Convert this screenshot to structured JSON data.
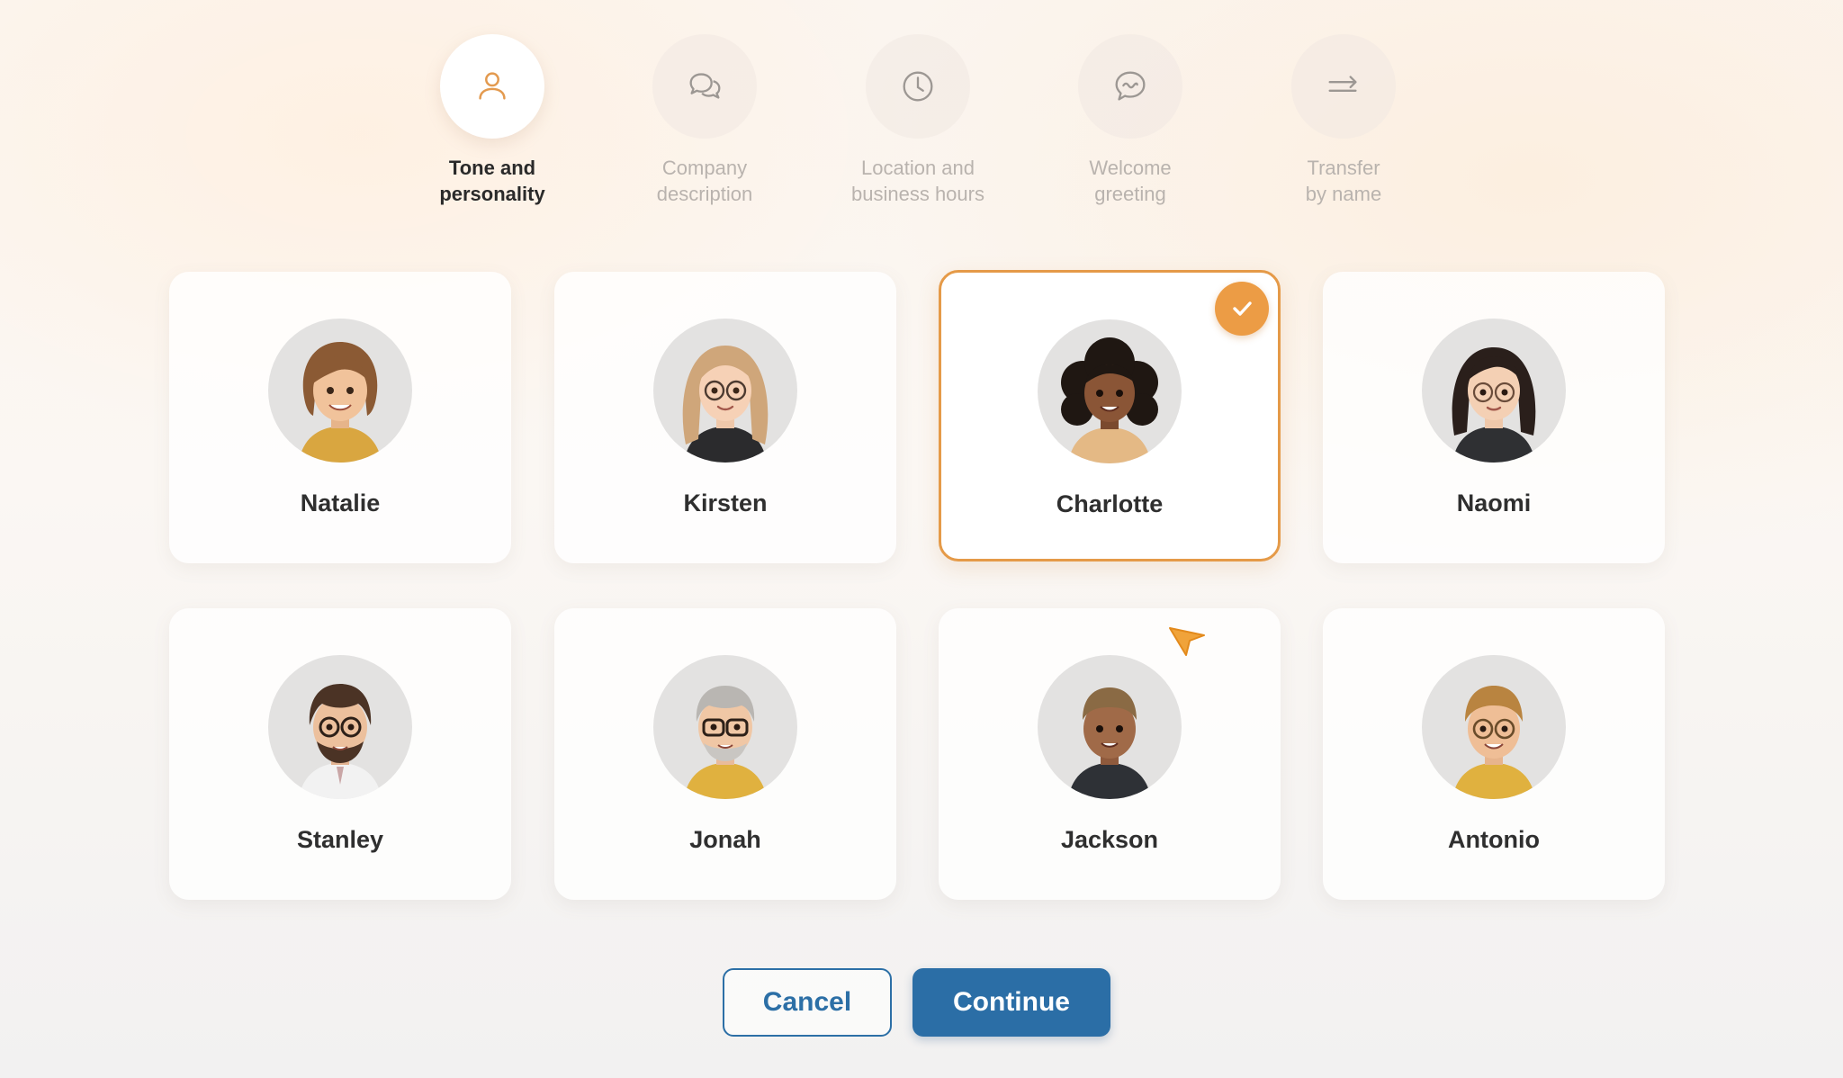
{
  "stepper": {
    "steps": [
      {
        "label": "Tone and\npersonality",
        "icon": "person-icon",
        "active": true
      },
      {
        "label": "Company\ndescription",
        "icon": "chat-bubbles-icon",
        "active": false
      },
      {
        "label": "Location and\nbusiness hours",
        "icon": "clock-icon",
        "active": false
      },
      {
        "label": "Welcome\ngreeting",
        "icon": "message-wave-icon",
        "active": false
      },
      {
        "label": "Transfer\nby name",
        "icon": "transfer-arrows-icon",
        "active": false
      }
    ]
  },
  "personas": [
    {
      "name": "Natalie",
      "selected": false
    },
    {
      "name": "Kirsten",
      "selected": false
    },
    {
      "name": "Charlotte",
      "selected": true
    },
    {
      "name": "Naomi",
      "selected": false
    },
    {
      "name": "Stanley",
      "selected": false
    },
    {
      "name": "Jonah",
      "selected": false
    },
    {
      "name": "Jackson",
      "selected": false
    },
    {
      "name": "Antonio",
      "selected": false
    }
  ],
  "actions": {
    "cancel_label": "Cancel",
    "continue_label": "Continue"
  },
  "colors": {
    "accent_orange": "#ec9c45",
    "primary_blue": "#2b6ea6"
  }
}
